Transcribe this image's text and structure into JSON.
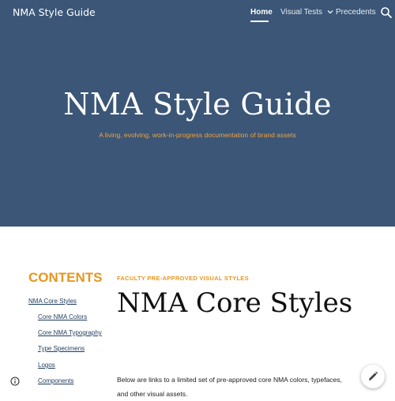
{
  "header": {
    "site_title": "NMA Style Guide",
    "nav": [
      {
        "label": "Home",
        "active": true
      },
      {
        "label": "Visual Tests",
        "has_dropdown": true
      },
      {
        "label": "Precedents"
      }
    ],
    "search_icon": "search-icon"
  },
  "hero": {
    "title": "NMA Style Guide",
    "subtitle": "A living, evolving, work-in-progress documentation of brand assets"
  },
  "toc": {
    "heading": "CONTENTS",
    "items": [
      {
        "label": "NMA Core Styles",
        "level": 1
      },
      {
        "label": "Core NMA Colors",
        "level": 2
      },
      {
        "label": "Core NMA Typography",
        "level": 2
      },
      {
        "label": "Type Specimens",
        "level": 2
      },
      {
        "label": "Logos",
        "level": 2
      },
      {
        "label": "Components",
        "level": 2
      }
    ]
  },
  "main": {
    "eyebrow": "FACULTY PRE-APPROVED VISUAL STYLES",
    "heading": "NMA Core Styles",
    "intro": "Below are links to a limited set of pre-approved core NMA colors, typefaces, and other visual assets."
  },
  "controls": {
    "info_icon": "info-icon",
    "edit_icon": "pencil-icon"
  },
  "colors": {
    "hero_bg": "#3b5677",
    "accent": "#e8961f",
    "link": "#1f3a5e"
  }
}
